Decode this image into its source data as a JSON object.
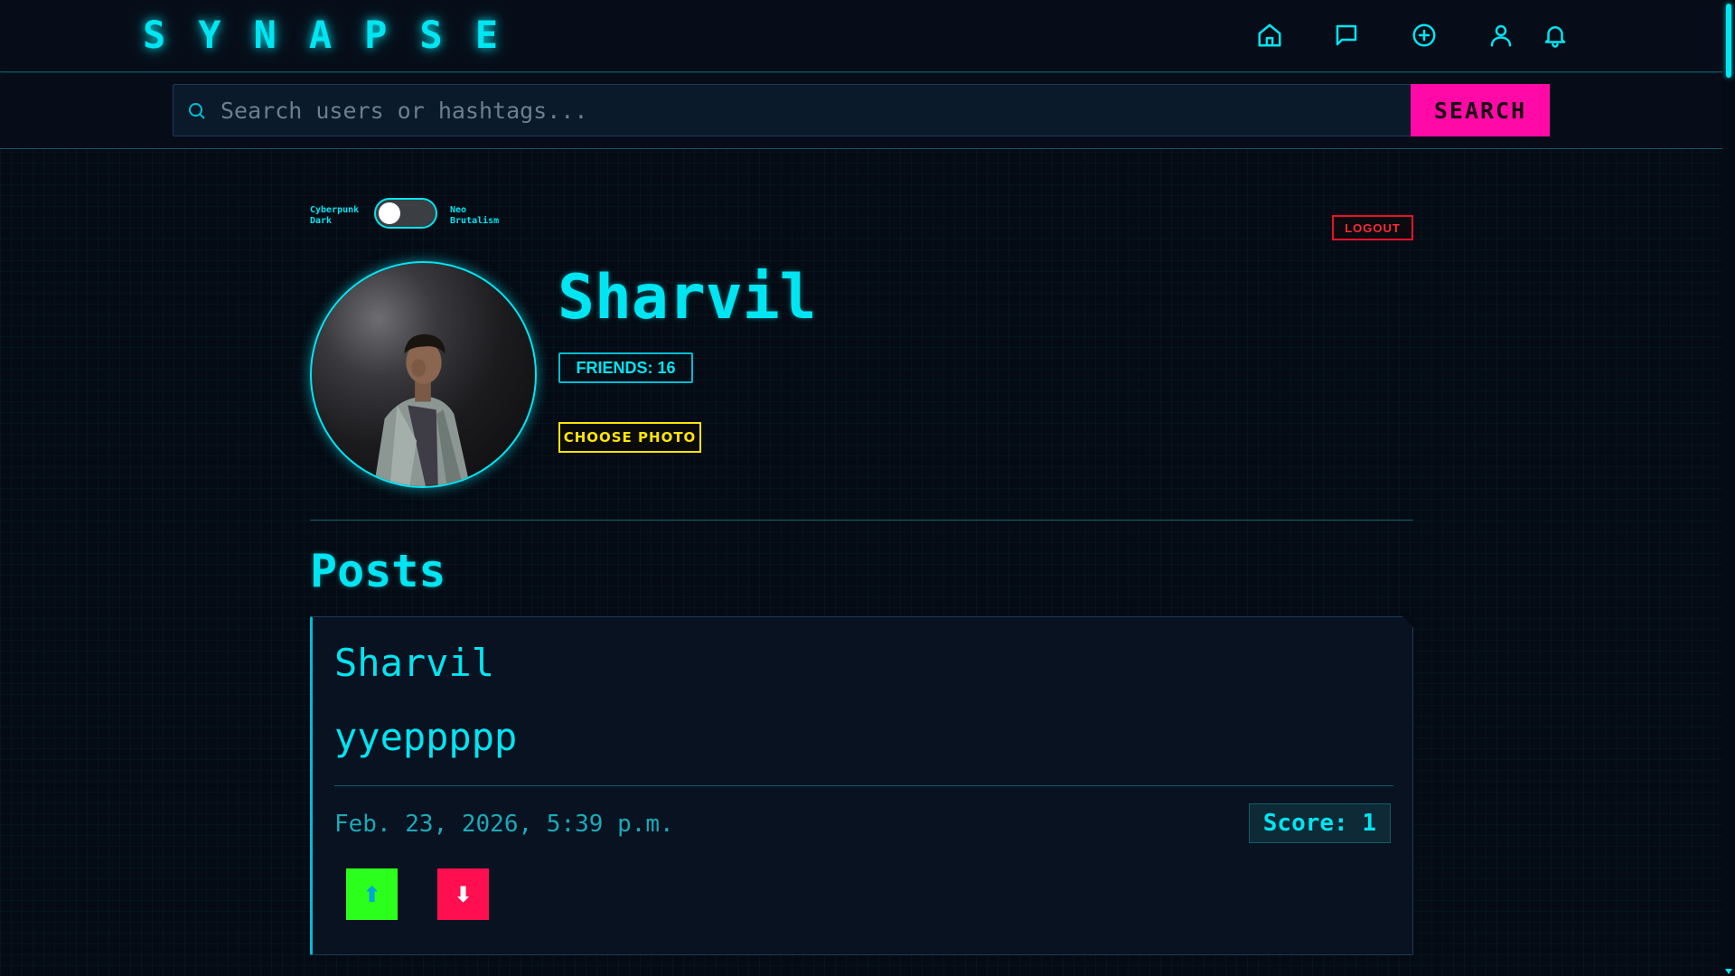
{
  "header": {
    "brand": "SYNAPSE",
    "nav": [
      {
        "name": "home",
        "icon": "home-icon"
      },
      {
        "name": "messages",
        "icon": "chat-bubble-icon"
      },
      {
        "name": "create",
        "icon": "plus-circle-icon"
      },
      {
        "name": "profile",
        "icon": "user-icon"
      },
      {
        "name": "notifications",
        "icon": "bell-icon"
      }
    ]
  },
  "search": {
    "placeholder": "Search users or hashtags...",
    "value": "",
    "button_label": "SEARCH"
  },
  "theme_toggle": {
    "left_label": "Cyberpunk\nDark",
    "right_label": "Neo\nBrutalism",
    "state": "left"
  },
  "profile": {
    "logout_label": "LOGOUT",
    "name": "Sharvil",
    "friends_label": "FRIENDS: 16",
    "choose_photo_label": "CHOOSE PHOTO"
  },
  "posts": {
    "heading": "Posts",
    "items": [
      {
        "author": "Sharvil",
        "body": "yyeppppp",
        "date": "Feb. 23, 2026, 5:39 p.m.",
        "score_label": "Score: 1",
        "upvote_symbol": "⬆",
        "downvote_symbol": "⬇"
      }
    ]
  },
  "colors": {
    "accent": "#00e5f2",
    "search_button": "#ff0aa6",
    "logout": "#e8102c",
    "choose_photo": "#ffe600",
    "upvote": "#2bff1c",
    "downvote": "#ff0f4f",
    "background": "#050b14"
  }
}
